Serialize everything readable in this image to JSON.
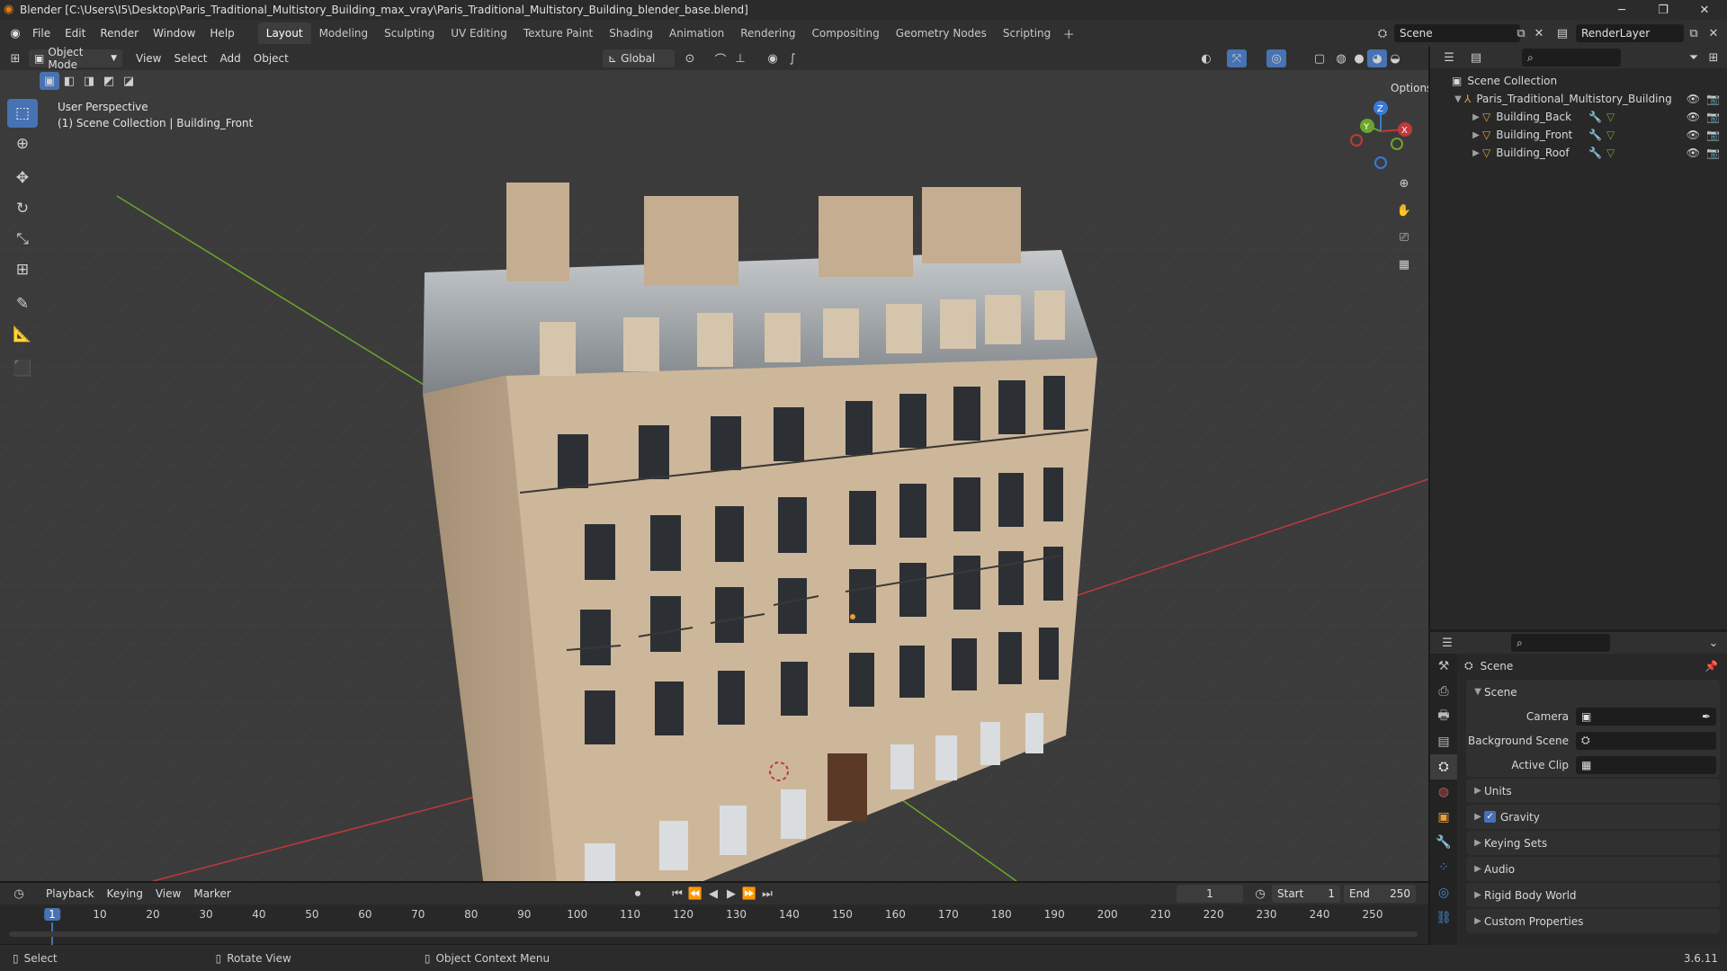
{
  "window": {
    "title": "Blender [C:\\Users\\I5\\Desktop\\Paris_Traditional_Multistory_Building_max_vray\\Paris_Traditional_Multistory_Building_blender_base.blend]"
  },
  "menus": [
    "File",
    "Edit",
    "Render",
    "Window",
    "Help"
  ],
  "workspaces": [
    "Layout",
    "Modeling",
    "Sculpting",
    "UV Editing",
    "Texture Paint",
    "Shading",
    "Animation",
    "Rendering",
    "Compositing",
    "Geometry Nodes",
    "Scripting"
  ],
  "active_workspace": "Layout",
  "scene_field": "Scene",
  "renderlayer_field": "RenderLayer",
  "viewport_header": {
    "mode": "Object Mode",
    "menus": [
      "View",
      "Select",
      "Add",
      "Object"
    ],
    "transform": "Global",
    "options": "Options"
  },
  "viewport": {
    "perspective": "User Perspective",
    "collection_info": "(1) Scene Collection | Building_Front",
    "gizmo": {
      "x": "X",
      "y": "Y",
      "z": "Z"
    }
  },
  "outliner": {
    "root": "Scene Collection",
    "collection": "Paris_Traditional_Multistory_Building",
    "objects": [
      "Building_Back",
      "Building_Front",
      "Building_Roof"
    ]
  },
  "properties": {
    "context": "Scene",
    "panel_title": "Scene",
    "camera_label": "Camera",
    "background_label": "Background Scene",
    "clip_label": "Active Clip",
    "sections": [
      "Units",
      "Gravity",
      "Keying Sets",
      "Audio",
      "Rigid Body World",
      "Custom Properties"
    ],
    "gravity_checked": true
  },
  "timeline": {
    "menus": [
      "Playback",
      "Keying",
      "View",
      "Marker"
    ],
    "current_frame": "1",
    "start_label": "Start",
    "start": "1",
    "end_label": "End",
    "end": "250",
    "ticks": [
      "1",
      "10",
      "20",
      "30",
      "40",
      "50",
      "60",
      "70",
      "80",
      "90",
      "100",
      "110",
      "120",
      "130",
      "140",
      "150",
      "160",
      "170",
      "180",
      "190",
      "200",
      "210",
      "220",
      "230",
      "240",
      "250"
    ]
  },
  "statusbar": {
    "select": "Select",
    "rotate": "Rotate View",
    "context_menu": "Object Context Menu",
    "version": "3.6.11"
  },
  "colors": {
    "accent": "#4772b3",
    "axis_x": "#c0393b",
    "axis_y": "#6da52c",
    "axis_z": "#3b79d6",
    "facade": "#cdb79b",
    "roof": "#9ea3a8"
  }
}
